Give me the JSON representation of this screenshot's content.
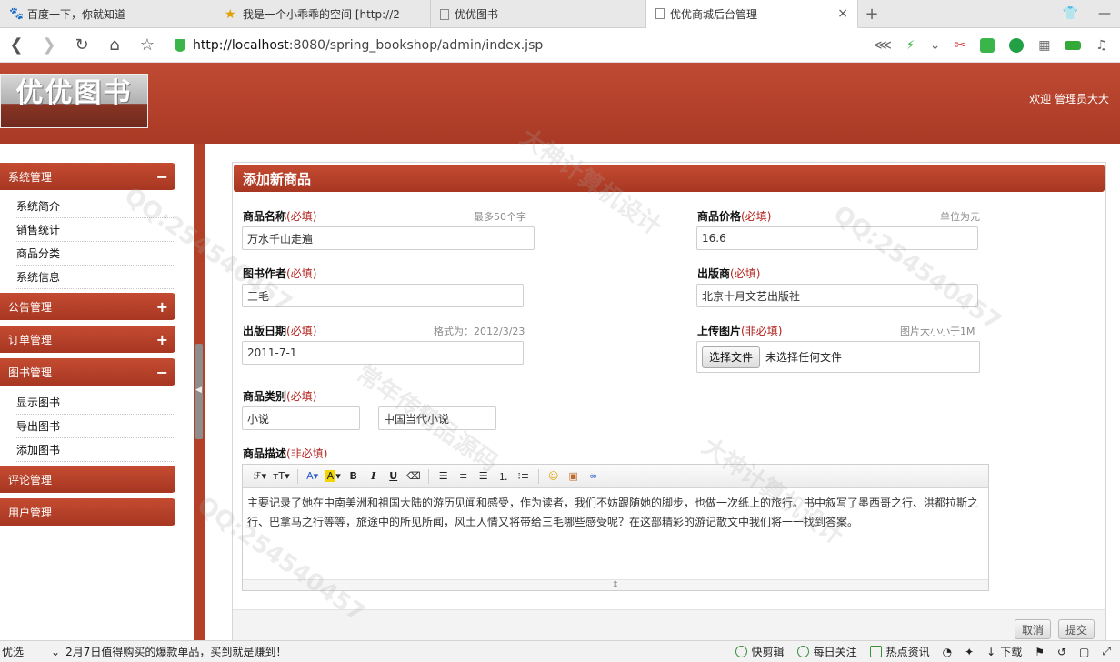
{
  "browser": {
    "tabs": [
      {
        "title": "百度一下，你就知道",
        "icon": "baidu-paw-icon"
      },
      {
        "title": "我是一个小乖乖的空间 [http://2",
        "icon": "star-icon"
      },
      {
        "title": "优优图书",
        "icon": "page-icon"
      },
      {
        "title": "优优商城后台管理",
        "icon": "page-icon",
        "close": "×"
      }
    ],
    "new_tab": "+",
    "url_host": "http://localhost",
    "url_rest": ":8080/spring_bookshop/admin/index.jsp"
  },
  "header": {
    "logo_text": "优优图书",
    "welcome": "欢迎  管理员大大",
    "color_primary": "#b0412a"
  },
  "sidebar": {
    "groups": [
      {
        "label": "系统管理",
        "toggle": "−",
        "items": [
          "系统简介",
          "销售统计",
          "商品分类",
          "系统信息"
        ]
      },
      {
        "label": "公告管理",
        "toggle": "+"
      },
      {
        "label": "订单管理",
        "toggle": "+"
      },
      {
        "label": "图书管理",
        "toggle": "−",
        "items": [
          "显示图书",
          "导出图书",
          "添加图书"
        ]
      },
      {
        "label": "评论管理"
      },
      {
        "label": "用户管理"
      }
    ]
  },
  "form": {
    "title": "添加新商品",
    "name": {
      "label": "商品名称",
      "req": "(必填)",
      "hint": "最多50个字",
      "value": "万水千山走遍"
    },
    "price": {
      "label": "商品价格",
      "req": "(必填)",
      "hint": "单位为元",
      "value": "16.6"
    },
    "author": {
      "label": "图书作者",
      "req": "(必填)",
      "value": "三毛"
    },
    "publisher": {
      "label": "出版商",
      "req": "(必填)",
      "value": "北京十月文艺出版社"
    },
    "date": {
      "label": "出版日期",
      "req": "(必填)",
      "hint": "格式为：2012/3/23",
      "value": "2011-7-1"
    },
    "image": {
      "label": "上传图片",
      "req": "(非必填)",
      "hint": "图片大小小于1M",
      "button": "选择文件",
      "status": "未选择任何文件"
    },
    "category": {
      "label": "商品类别",
      "req": "(必填)",
      "value1": "小说",
      "value2": "中国当代小说"
    },
    "desc": {
      "label": "商品描述",
      "req": "(非必填)",
      "text": "主要记录了她在中南美洲和祖国大陆的游历见闻和感受，作为读者，我们不妨跟随她的脚步，也做一次纸上的旅行。书中叙写了墨西哥之行、洪都拉斯之行、巴拿马之行等等，旅途中的所见所闻，风土人情又将带给三毛哪些感受呢？在这部精彩的游记散文中我们将一一找到答案。"
    },
    "cancel": "取消",
    "submit": "提交"
  },
  "statusbar": {
    "left": "优选",
    "news": "2月7日值得购买的爆款单品，买到就是赚到！",
    "items": [
      "快剪辑",
      "每日关注",
      "热点资讯",
      "下载"
    ]
  },
  "watermarks": [
    "QQ:254540457",
    "大神计算机设计",
    "常年传精品源码"
  ]
}
